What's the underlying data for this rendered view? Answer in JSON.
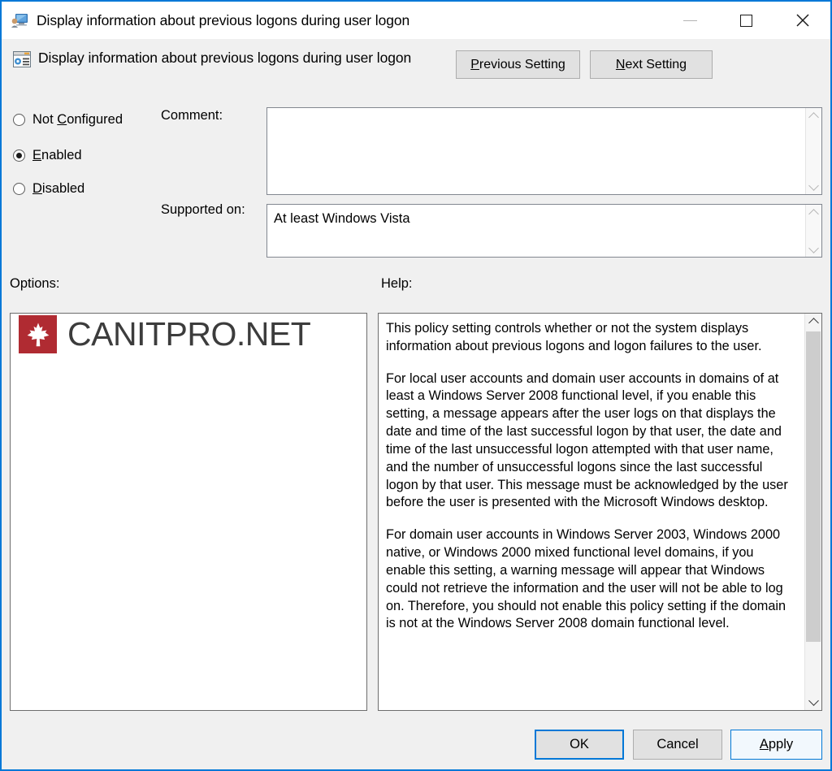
{
  "window": {
    "title": "Display information about previous logons during user logon",
    "icon": "computer-monitor-icon",
    "accent_color": "#0078d7",
    "background_color": "#f0f0f0",
    "caption": {
      "minimize_label": "Minimize",
      "maximize_label": "Maximize",
      "close_label": "Close"
    }
  },
  "header": {
    "setting_title": "Display information about previous logons during user logon",
    "setting_icon": "policy-setting-icon",
    "previous_button": {
      "accel": "P",
      "rest": "revious Setting"
    },
    "next_button": {
      "accel": "N",
      "rest": "ext Setting"
    }
  },
  "state": {
    "options": [
      {
        "id": "not-configured",
        "pre": "Not ",
        "accel": "C",
        "post": "onfigured",
        "selected": false
      },
      {
        "id": "enabled",
        "pre": "",
        "accel": "E",
        "post": "nabled",
        "selected": true
      },
      {
        "id": "disabled",
        "pre": "",
        "accel": "D",
        "post": "isabled",
        "selected": false
      }
    ],
    "selected_value": "Enabled"
  },
  "comment": {
    "label": "Comment:",
    "value": "",
    "placeholder": ""
  },
  "supported_on": {
    "label": "Supported on:",
    "value": "At least Windows Vista"
  },
  "panes": {
    "options_label": "Options:",
    "help_label": "Help:"
  },
  "watermark": {
    "brand_text": "CANITPRO.NET",
    "badge_icon": "maple-leaf-icon",
    "badge_color": "#b02b32"
  },
  "help": {
    "paragraphs": [
      "This policy setting controls whether or not the system displays information about previous logons and logon failures to the user.",
      "For local user accounts and domain user accounts in domains of at least a Windows Server 2008 functional level, if you enable this setting, a message appears after the user logs on that displays the date and time of the last successful logon by that user, the date and time of the last unsuccessful logon attempted with that user name, and the number of unsuccessful logons since the last successful logon by that user. This message must be acknowledged by the user before the user is presented with the Microsoft Windows desktop.",
      "For domain user accounts in Windows Server 2003, Windows 2000 native, or Windows 2000 mixed functional level domains, if you enable this setting, a warning message will appear that Windows could not retrieve the information and the user will not be able to log on. Therefore, you should not enable this policy setting if the domain is not at the Windows Server 2008 domain functional level."
    ]
  },
  "footer": {
    "ok_label": "OK",
    "cancel_label": "Cancel",
    "apply": {
      "accel": "A",
      "rest": "pply"
    }
  }
}
